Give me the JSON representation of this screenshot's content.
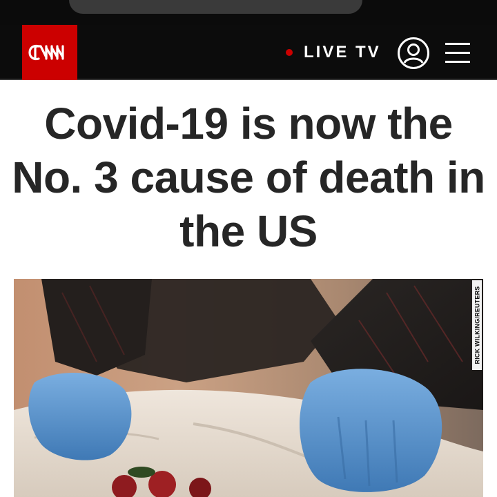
{
  "header": {
    "logo_text": "CNN",
    "live_label": "LIVE TV",
    "icons": {
      "logo": "cnn-logo",
      "live_indicator": "live-dot-icon",
      "account": "account-icon",
      "menu": "hamburger-menu-icon"
    },
    "colors": {
      "header_bg": "#0c0c0c",
      "brand_red": "#cc0000",
      "text": "#ffffff"
    }
  },
  "article": {
    "headline": "Covid-19 is now the No. 3 cause of death in the US",
    "image": {
      "description_icon": "hero-photo",
      "credit": "RICK WILKING/REUTERS"
    }
  }
}
